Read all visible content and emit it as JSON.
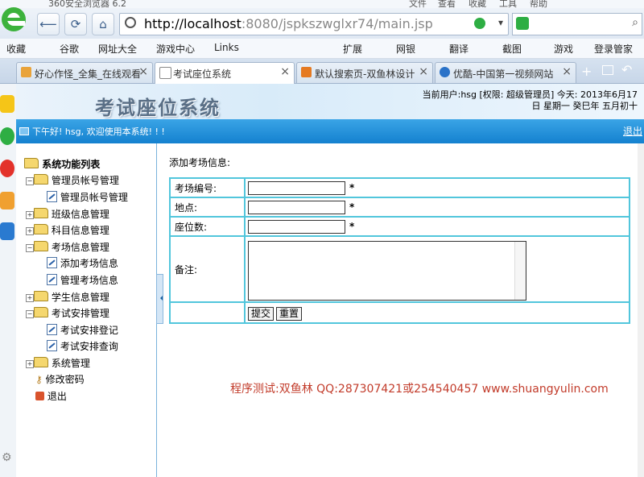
{
  "browser": {
    "app_name": "360安全浏览器 6.2",
    "menu": [
      "文件",
      "查看",
      "收藏",
      "工具",
      "帮助"
    ],
    "address_host": "http://localhost",
    "address_path": ":8080/jspkszwglxr74/main.jsp",
    "bookmarks": [
      "收藏",
      "谷歌",
      "网址大全",
      "游戏中心",
      "Links",
      "扩展",
      "网银",
      "翻译",
      "截图",
      "游戏",
      "登录管家"
    ],
    "tabs": [
      {
        "label": "好心作怪_全集_在线观看",
        "active": false
      },
      {
        "label": "考试座位系统",
        "active": true
      },
      {
        "label": "默认搜索页-双鱼林设计",
        "active": false
      },
      {
        "label": "优酷-中国第一视频网站",
        "active": false
      }
    ]
  },
  "header": {
    "title": "考试座位系统",
    "user_line1": "当前用户:hsg [权限: 超级管理员] 今天: 2013年6月17",
    "user_line2": "日 星期一 癸巳年 五月初十",
    "welcome": "下午好! hsg, 欢迎使用本系统! ! !",
    "logout": "退出"
  },
  "menu": {
    "root": "系统功能列表",
    "items": [
      {
        "label": "管理员帐号管理",
        "level": 1,
        "type": "folder",
        "expanded": true
      },
      {
        "label": "管理员帐号管理",
        "level": 2,
        "type": "doc"
      },
      {
        "label": "班级信息管理",
        "level": 1,
        "type": "folder",
        "expanded": false
      },
      {
        "label": "科目信息管理",
        "level": 1,
        "type": "folder",
        "expanded": false
      },
      {
        "label": "考场信息管理",
        "level": 1,
        "type": "folder",
        "expanded": true
      },
      {
        "label": "添加考场信息",
        "level": 2,
        "type": "doc"
      },
      {
        "label": "管理考场信息",
        "level": 2,
        "type": "doc"
      },
      {
        "label": "学生信息管理",
        "level": 1,
        "type": "folder",
        "expanded": false
      },
      {
        "label": "考试安排管理",
        "level": 1,
        "type": "folder",
        "expanded": true
      },
      {
        "label": "考试安排登记",
        "level": 2,
        "type": "doc"
      },
      {
        "label": "考试安排查询",
        "level": 2,
        "type": "doc"
      },
      {
        "label": "系统管理",
        "level": 1,
        "type": "folder",
        "expanded": false
      },
      {
        "label": "修改密码",
        "level": 1,
        "type": "key"
      },
      {
        "label": "退出",
        "level": 1,
        "type": "exit"
      }
    ]
  },
  "content": {
    "title": "添加考场信息:",
    "fields": [
      {
        "label": "考场编号:",
        "value": "",
        "required": "*"
      },
      {
        "label": "地点:",
        "value": "",
        "required": "*"
      },
      {
        "label": "座位数:",
        "value": "",
        "required": "*"
      }
    ],
    "remark_label": "备注:",
    "submit": "提交",
    "reset": "重置",
    "credit": "程序测试:双鱼林 QQ:287307421或254540457 www.shuangyulin.com"
  }
}
